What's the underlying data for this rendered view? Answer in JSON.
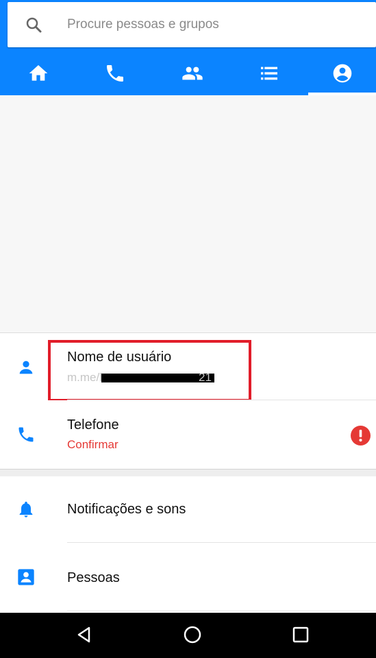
{
  "search": {
    "placeholder": "Procure pessoas e grupos"
  },
  "tabs": [
    {
      "icon": "home-icon"
    },
    {
      "icon": "phone-icon"
    },
    {
      "icon": "people-icon"
    },
    {
      "icon": "list-icon"
    },
    {
      "icon": "account-circle-icon",
      "selected": true
    }
  ],
  "settings": {
    "username": {
      "title": "Nome de usuário",
      "value": "m.me/l",
      "value_tail": "21"
    },
    "phone": {
      "title": "Telefone",
      "status": "Confirmar"
    },
    "notifications": {
      "title": "Notificações e sons"
    },
    "people": {
      "title": "Pessoas"
    }
  },
  "colors": {
    "accent": "#0b84ff",
    "warning": "#e53935",
    "highlight": "#e11d2a"
  },
  "navbar": {
    "buttons": [
      "back-icon",
      "home-circle-icon",
      "recents-icon"
    ]
  }
}
